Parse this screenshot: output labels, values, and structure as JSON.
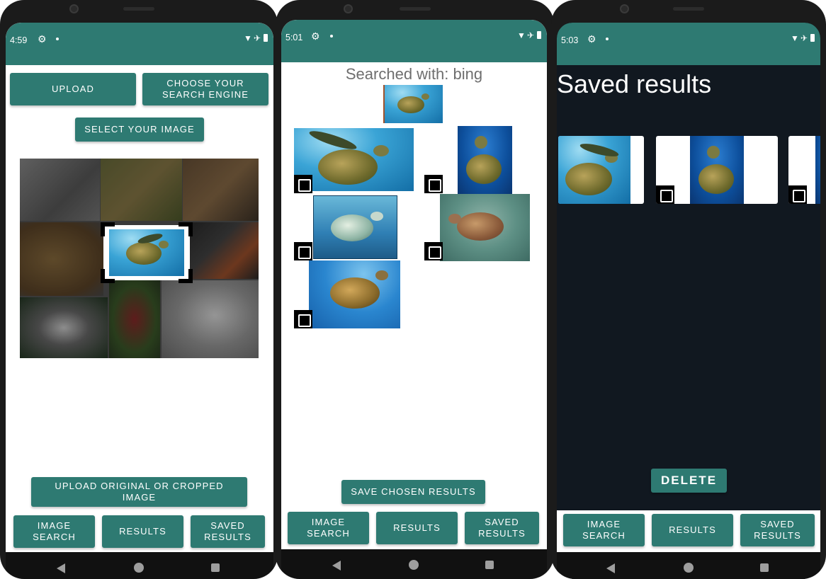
{
  "screen1": {
    "status_time": "4:59",
    "buttons": {
      "upload": "UPLOAD",
      "choose_engine": "CHOOSE YOUR SEARCH ENGINE",
      "select_image": "SELECT YOUR IMAGE",
      "upload_original": "UPLOAD ORIGINAL OR CROPPED IMAGE"
    },
    "grid_animals": [
      "wolf",
      "giraffe",
      "tiger",
      "lion",
      "turtle",
      "toucan",
      "panda",
      "frog",
      "polar bear"
    ]
  },
  "screen2": {
    "status_time": "5:01",
    "searched_with": "Searched with: bing",
    "save_button": "SAVE CHOSEN RESULTS"
  },
  "screen3": {
    "status_time": "5:03",
    "title": "Saved results",
    "delete_button": "DELETE"
  },
  "bottom_nav": {
    "image_search": "IMAGE SEARCH",
    "results": "RESULTS",
    "saved_results": "SAVED RESULTS"
  },
  "colors": {
    "accent": "#2e7a72",
    "dark_background": "#111820",
    "overlay_dim": "#808080"
  },
  "icons": [
    "gear-icon",
    "wifi-icon",
    "airplane-icon",
    "battery-icon",
    "back-icon",
    "home-icon",
    "recent-apps-icon",
    "checkbox-icon"
  ]
}
